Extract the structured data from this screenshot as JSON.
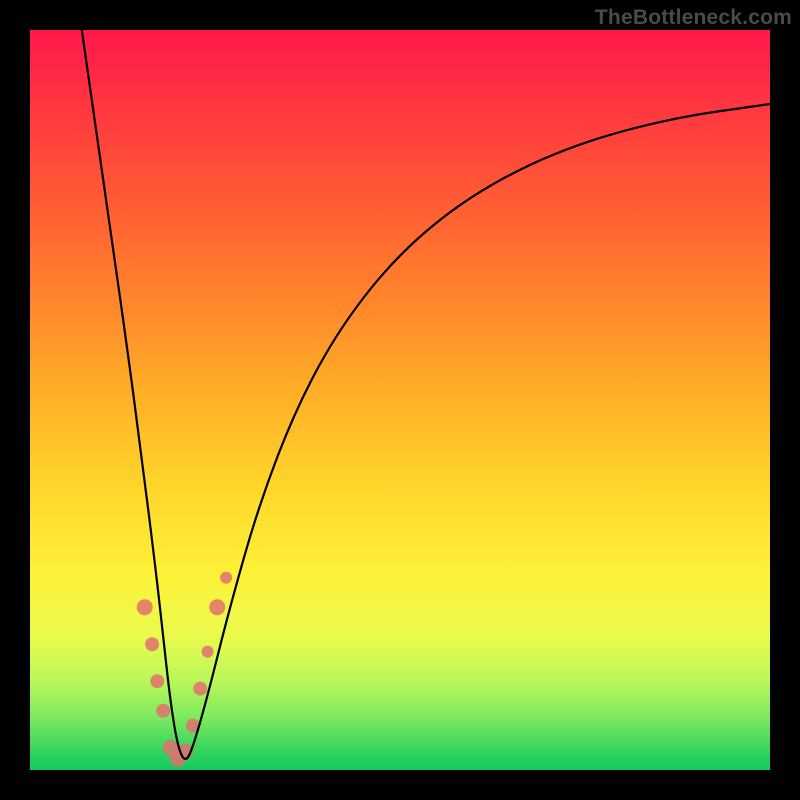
{
  "watermark": "TheBottleneck.com",
  "chart_data": {
    "type": "line",
    "title": "",
    "xlabel": "",
    "ylabel": "",
    "xlim": [
      0,
      100
    ],
    "ylim": [
      0,
      100
    ],
    "grid": false,
    "legend": false,
    "series": [
      {
        "name": "bottleneck-curve",
        "x": [
          7,
          9,
          11,
          13,
          15,
          17,
          18,
          19,
          20,
          21,
          22,
          24,
          27,
          31,
          36,
          42,
          50,
          60,
          72,
          86,
          100
        ],
        "values": [
          100,
          86,
          72,
          58,
          43,
          27,
          18,
          9,
          3,
          1,
          3,
          10,
          22,
          36,
          49,
          60,
          70,
          78,
          84,
          88,
          90
        ],
        "color": "#000000"
      }
    ],
    "markers": [
      {
        "name": "dot-left-upper",
        "x": 15.5,
        "y": 22,
        "r": 8,
        "color": "#e17070"
      },
      {
        "name": "dot-left-mid1",
        "x": 16.5,
        "y": 17,
        "r": 7,
        "color": "#e17070"
      },
      {
        "name": "dot-left-mid2",
        "x": 17.2,
        "y": 12,
        "r": 7,
        "color": "#e17070"
      },
      {
        "name": "dot-left-low",
        "x": 18.0,
        "y": 8,
        "r": 7,
        "color": "#e17070"
      },
      {
        "name": "dot-bottom-l1",
        "x": 19.0,
        "y": 3,
        "r": 8,
        "color": "#e17070"
      },
      {
        "name": "dot-bottom-min",
        "x": 20.0,
        "y": 1.5,
        "r": 8,
        "color": "#e17070"
      },
      {
        "name": "dot-bottom-r1",
        "x": 21.0,
        "y": 2.5,
        "r": 8,
        "color": "#e17070"
      },
      {
        "name": "dot-right-low",
        "x": 22.0,
        "y": 6,
        "r": 7,
        "color": "#e17070"
      },
      {
        "name": "dot-right-mid1",
        "x": 23.0,
        "y": 11,
        "r": 7,
        "color": "#e17070"
      },
      {
        "name": "dot-right-mid2",
        "x": 24.0,
        "y": 16,
        "r": 6,
        "color": "#e17070"
      },
      {
        "name": "dot-right-upper",
        "x": 25.3,
        "y": 22,
        "r": 8,
        "color": "#e17070"
      },
      {
        "name": "dot-right-upper2",
        "x": 26.5,
        "y": 26,
        "r": 6,
        "color": "#e17070"
      }
    ]
  }
}
